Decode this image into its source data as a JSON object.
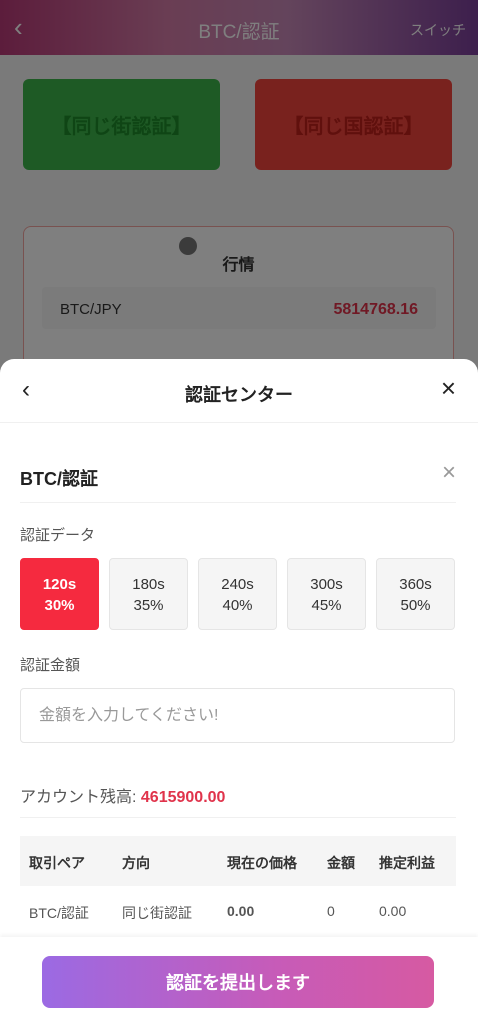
{
  "header": {
    "back_icon": "‹",
    "title": "BTC/認証",
    "switch_label": "スイッチ"
  },
  "background": {
    "btn_same_street": "【同じ街認証】",
    "btn_same_country": "【同じ国認証】",
    "market": {
      "title": "行情",
      "pair": "BTC/JPY",
      "price": "5814768.16"
    }
  },
  "sheet": {
    "title": "認証センター",
    "pair_title": "BTC/認証",
    "data_label": "認証データ",
    "options": [
      {
        "time": "120s",
        "rate": "30%",
        "active": true
      },
      {
        "time": "180s",
        "rate": "35%",
        "active": false
      },
      {
        "time": "240s",
        "rate": "40%",
        "active": false
      },
      {
        "time": "300s",
        "rate": "45%",
        "active": false
      },
      {
        "time": "360s",
        "rate": "50%",
        "active": false
      }
    ],
    "amount_label": "認証金額",
    "amount_placeholder": "金額を入力してください!",
    "balance_label": "アカウント残高:",
    "balance_value": "4615900.00",
    "table": {
      "headers": [
        "取引ペア",
        "方向",
        "現在の価格",
        "金額",
        "推定利益"
      ],
      "row": [
        "BTC/認証",
        "同じ街認証",
        "0.00",
        "0",
        "0.00"
      ]
    },
    "submit_label": "認証を提出します"
  },
  "colors": {
    "accent_red": "#f52a3f",
    "price_red": "#e0334b",
    "submit_start": "#9b6ae3",
    "submit_end": "#d65aa2"
  }
}
